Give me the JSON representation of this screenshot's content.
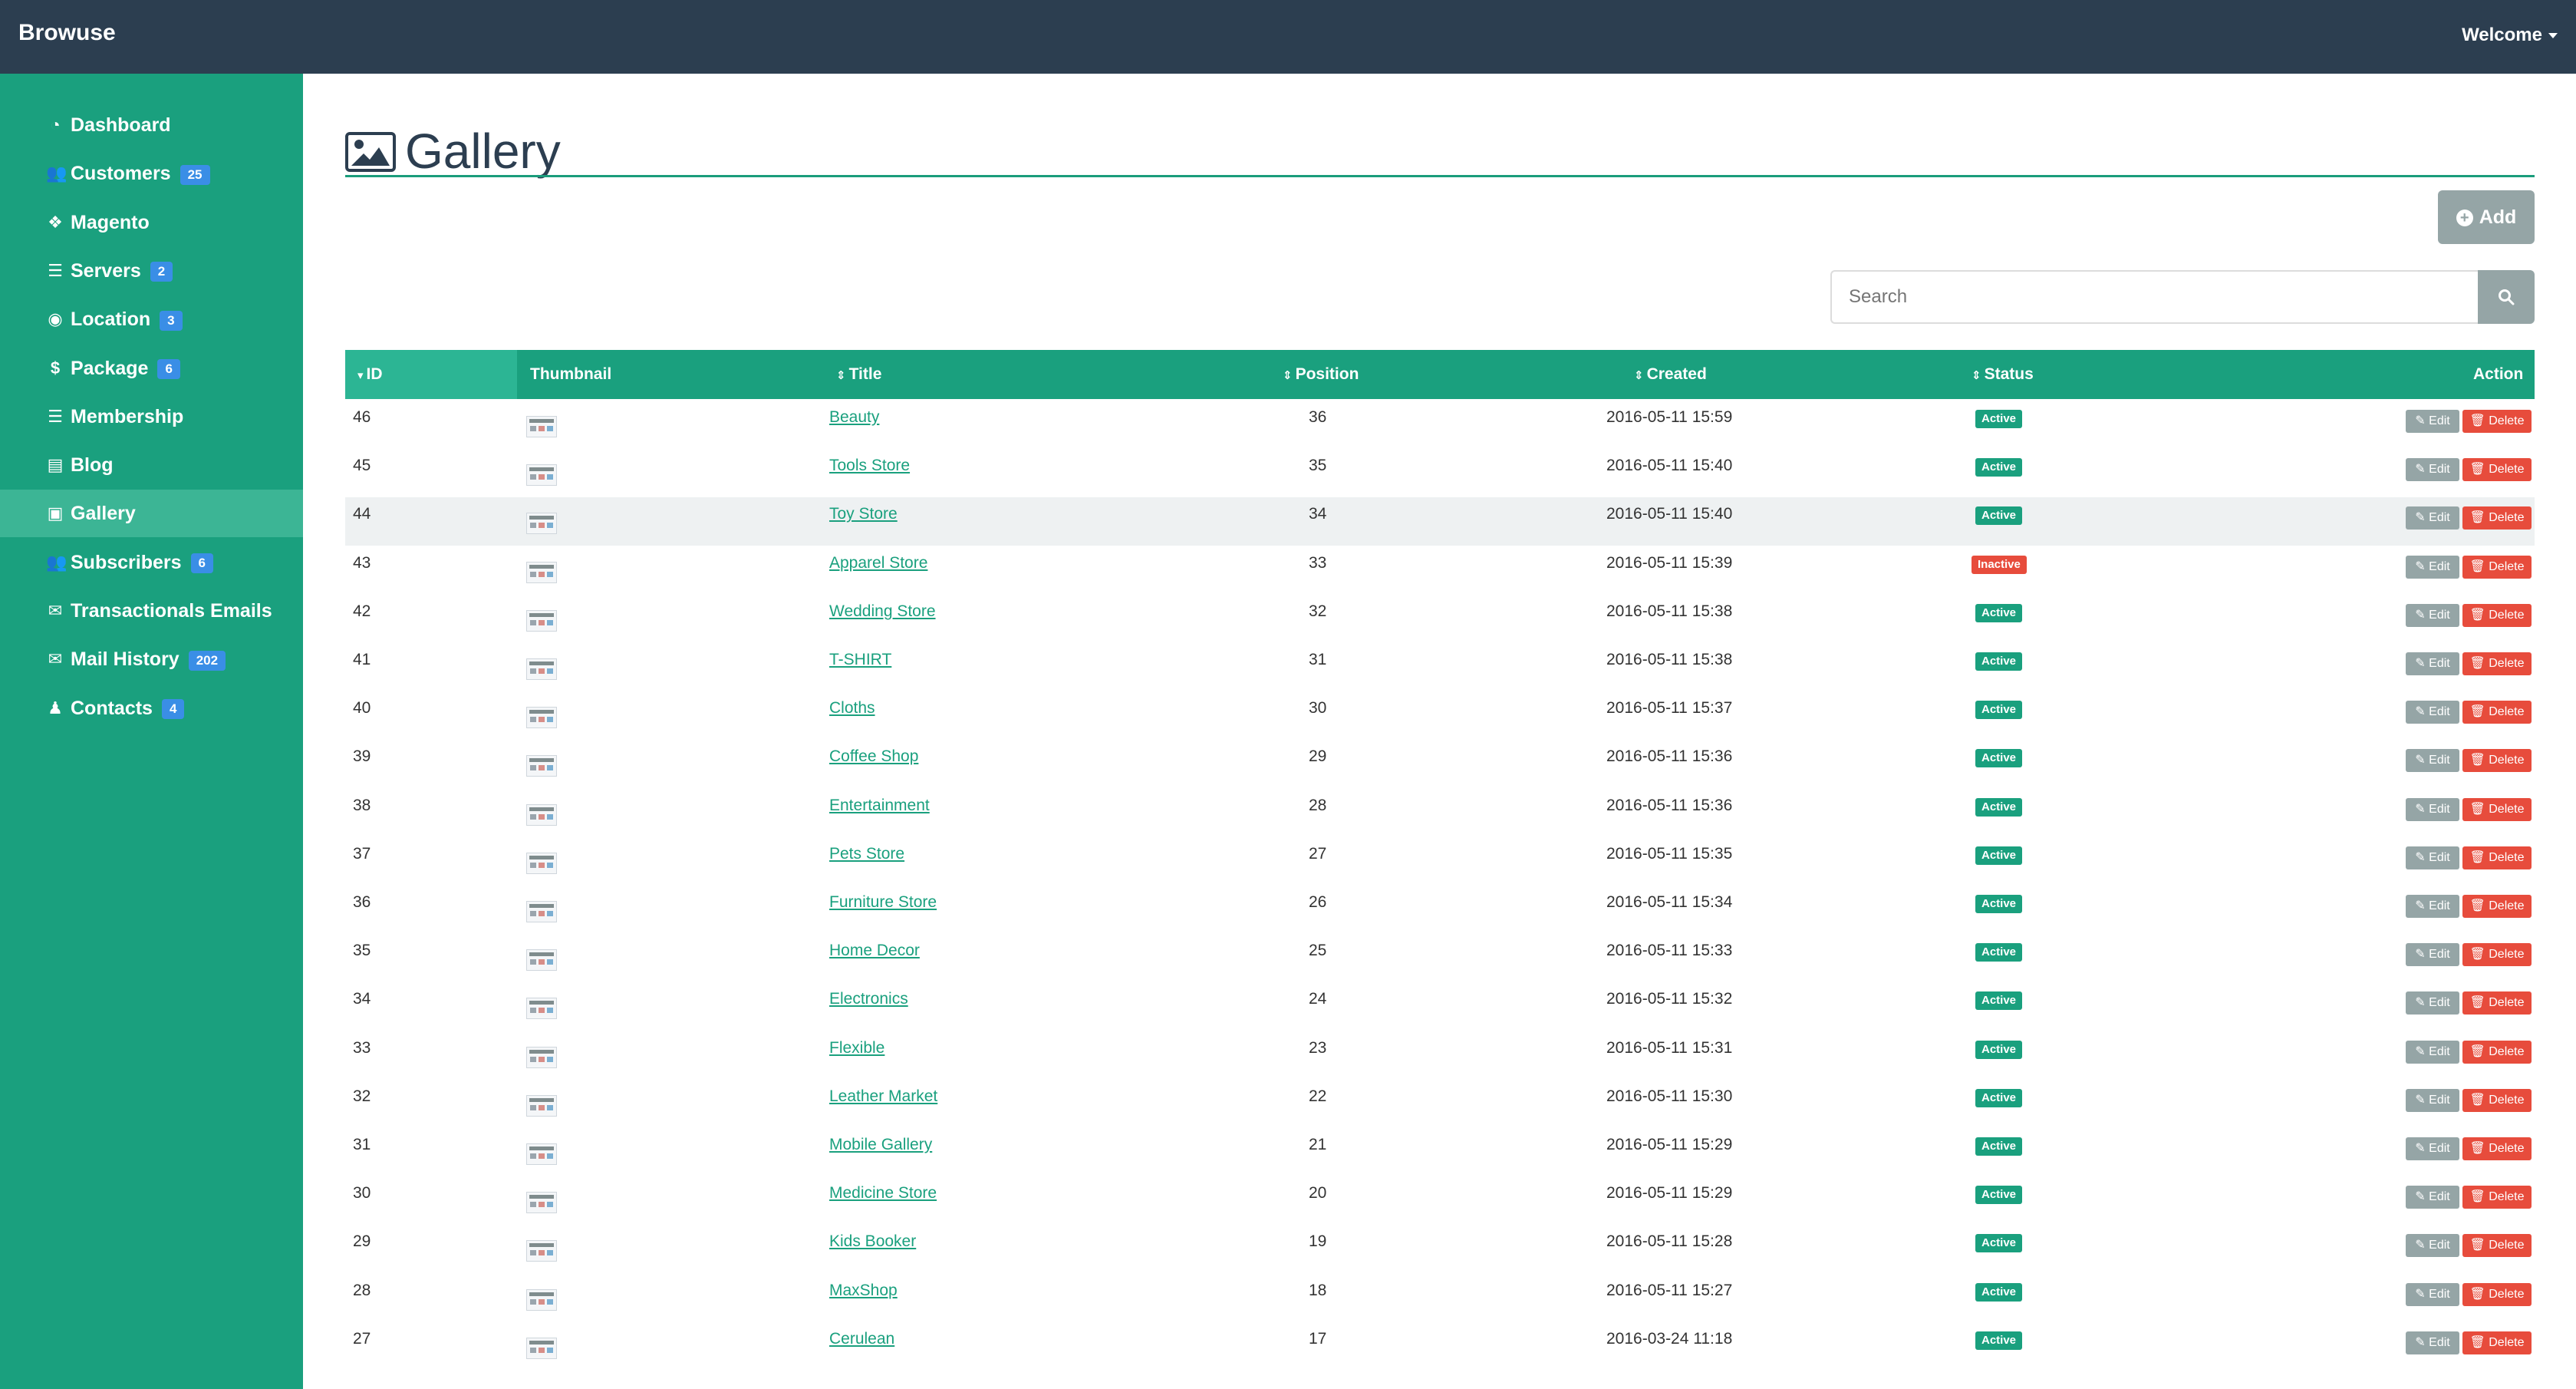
{
  "app": {
    "brand": "Browuse",
    "user_menu": "Welcome"
  },
  "sidebar": {
    "items": [
      {
        "label": "Dashboard",
        "icon": "dashboard-icon",
        "badge": null
      },
      {
        "label": "Customers",
        "icon": "users-icon",
        "badge": "25"
      },
      {
        "label": "Magento",
        "icon": "cubes-icon",
        "badge": null
      },
      {
        "label": "Servers",
        "icon": "server-icon",
        "badge": "2"
      },
      {
        "label": "Location",
        "icon": "globe-icon",
        "badge": "3"
      },
      {
        "label": "Package",
        "icon": "dollar-icon",
        "badge": "6"
      },
      {
        "label": "Membership",
        "icon": "list-icon",
        "badge": null
      },
      {
        "label": "Blog",
        "icon": "newspaper-icon",
        "badge": null
      },
      {
        "label": "Gallery",
        "icon": "image-icon",
        "badge": null,
        "active": true
      },
      {
        "label": "Subscribers",
        "icon": "users-icon",
        "badge": "6"
      },
      {
        "label": "Transactionals Emails",
        "icon": "envelope-icon",
        "badge": null
      },
      {
        "label": "Mail History",
        "icon": "envelope-icon",
        "badge": "202"
      },
      {
        "label": "Contacts",
        "icon": "user-plus-icon",
        "badge": "4"
      }
    ]
  },
  "page": {
    "title": "Gallery",
    "add_label": "Add",
    "search_placeholder": "Search"
  },
  "table": {
    "columns": [
      "ID",
      "Thumbnail",
      "Title",
      "Position",
      "Created",
      "Status",
      "Action"
    ],
    "edit_label": "Edit",
    "delete_label": "Delete",
    "rows": [
      {
        "id": "46",
        "title": "Beauty",
        "position": "36",
        "created": "2016-05-11 15:59",
        "status": "Active"
      },
      {
        "id": "45",
        "title": "Tools Store",
        "position": "35",
        "created": "2016-05-11 15:40",
        "status": "Active"
      },
      {
        "id": "44",
        "title": "Toy Store",
        "position": "34",
        "created": "2016-05-11 15:40",
        "status": "Active"
      },
      {
        "id": "43",
        "title": "Apparel Store",
        "position": "33",
        "created": "2016-05-11 15:39",
        "status": "Inactive"
      },
      {
        "id": "42",
        "title": "Wedding Store",
        "position": "32",
        "created": "2016-05-11 15:38",
        "status": "Active"
      },
      {
        "id": "41",
        "title": "T-SHIRT",
        "position": "31",
        "created": "2016-05-11 15:38",
        "status": "Active"
      },
      {
        "id": "40",
        "title": "Cloths",
        "position": "30",
        "created": "2016-05-11 15:37",
        "status": "Active"
      },
      {
        "id": "39",
        "title": "Coffee Shop",
        "position": "29",
        "created": "2016-05-11 15:36",
        "status": "Active"
      },
      {
        "id": "38",
        "title": "Entertainment",
        "position": "28",
        "created": "2016-05-11 15:36",
        "status": "Active"
      },
      {
        "id": "37",
        "title": "Pets Store",
        "position": "27",
        "created": "2016-05-11 15:35",
        "status": "Active"
      },
      {
        "id": "36",
        "title": "Furniture Store",
        "position": "26",
        "created": "2016-05-11 15:34",
        "status": "Active"
      },
      {
        "id": "35",
        "title": "Home Decor",
        "position": "25",
        "created": "2016-05-11 15:33",
        "status": "Active"
      },
      {
        "id": "34",
        "title": "Electronics",
        "position": "24",
        "created": "2016-05-11 15:32",
        "status": "Active"
      },
      {
        "id": "33",
        "title": "Flexible",
        "position": "23",
        "created": "2016-05-11 15:31",
        "status": "Active"
      },
      {
        "id": "32",
        "title": "Leather Market",
        "position": "22",
        "created": "2016-05-11 15:30",
        "status": "Active"
      },
      {
        "id": "31",
        "title": "Mobile Gallery",
        "position": "21",
        "created": "2016-05-11 15:29",
        "status": "Active"
      },
      {
        "id": "30",
        "title": "Medicine Store",
        "position": "20",
        "created": "2016-05-11 15:29",
        "status": "Active"
      },
      {
        "id": "29",
        "title": "Kids Booker",
        "position": "19",
        "created": "2016-05-11 15:28",
        "status": "Active"
      },
      {
        "id": "28",
        "title": "MaxShop",
        "position": "18",
        "created": "2016-05-11 15:27",
        "status": "Active"
      },
      {
        "id": "27",
        "title": "Cerulean",
        "position": "17",
        "created": "2016-03-24 11:18",
        "status": "Active"
      }
    ]
  },
  "colors": {
    "navbar": "#2c3e50",
    "sidebar": "#1aa07e",
    "sidebar_active": "#3cb595",
    "badge": "#3a8ee6",
    "active_status": "#1aa07e",
    "inactive_status": "#e74c3c",
    "edit_button": "#95a5a6",
    "delete_button": "#e74c3c"
  }
}
